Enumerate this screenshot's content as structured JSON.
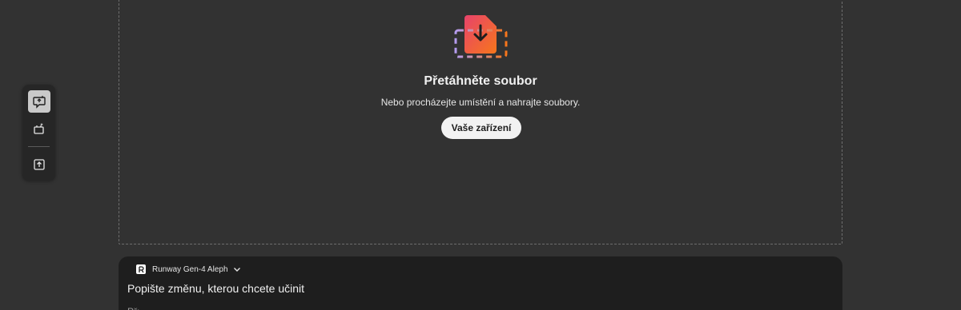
{
  "rail": {
    "buttons": [
      {
        "icon": "edit-video-icon",
        "active": true
      },
      {
        "icon": "generate-icon",
        "active": false
      },
      {
        "icon": "upload-icon",
        "active": false
      }
    ]
  },
  "dropzone": {
    "title": "Přetáhněte soubor",
    "subtitle": "Nebo procházejte umístění a nahrajte soubory.",
    "button_label": "Vaše zařízení",
    "icon": "file-drop-icon"
  },
  "prompt": {
    "model_name": "Runway Gen-4 Aleph",
    "model_logo": "R",
    "title": "Popište změnu, kterou chcete učinit",
    "placeholder": "Př: ..."
  },
  "colors": {
    "background": "#323232",
    "rail": "#262626",
    "panel": "#1e1e1e",
    "accent_gradient_start": "#e7436b",
    "accent_gradient_end": "#f7761b",
    "dashed_accent": "#b49cf0"
  }
}
